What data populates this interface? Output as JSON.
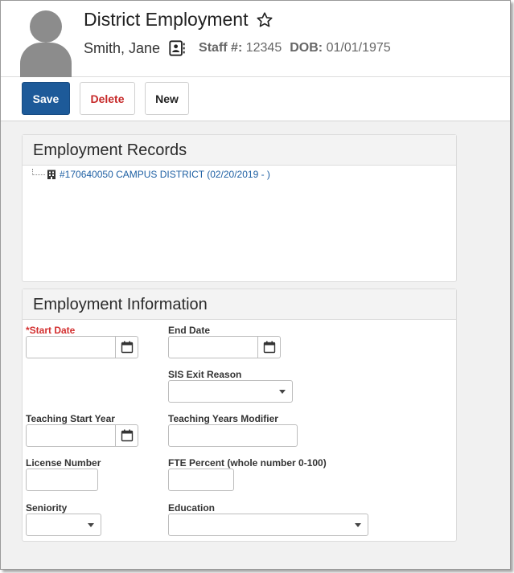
{
  "header": {
    "title": "District Employment",
    "person_name": "Smith, Jane",
    "staff_label": "Staff #:",
    "staff_value": "12345",
    "dob_label": "DOB:",
    "dob_value": "01/01/1975"
  },
  "toolbar": {
    "save_label": "Save",
    "delete_label": "Delete",
    "new_label": "New"
  },
  "records": {
    "title": "Employment Records",
    "items": [
      {
        "label": "#170640050 CAMPUS DISTRICT (02/20/2019 - )"
      }
    ]
  },
  "info": {
    "title": "Employment Information",
    "start_date": {
      "label": "*Start Date",
      "value": ""
    },
    "end_date": {
      "label": "End Date",
      "value": ""
    },
    "sis_exit_reason": {
      "label": "SIS Exit Reason",
      "value": ""
    },
    "teaching_start_year": {
      "label": "Teaching Start Year",
      "value": ""
    },
    "teaching_years_modifier": {
      "label": "Teaching Years Modifier",
      "value": ""
    },
    "license_number": {
      "label": "License Number",
      "value": ""
    },
    "fte_percent": {
      "label": "FTE Percent (whole number 0-100)",
      "value": ""
    },
    "seniority": {
      "label": "Seniority",
      "value": ""
    },
    "education": {
      "label": "Education",
      "value": ""
    }
  },
  "icons": {
    "avatar": "person-silhouette-icon",
    "favorite": "star-outline-icon",
    "contact": "contact-card-icon",
    "record": "building-icon",
    "date": "calendar-icon",
    "dropdown": "chevron-down-icon"
  },
  "colors": {
    "save_button": "#1d5a99",
    "delete_text": "#c62828",
    "link": "#1d5fa3",
    "required_label": "#d32f2f",
    "avatar": "#8c8c8c"
  }
}
